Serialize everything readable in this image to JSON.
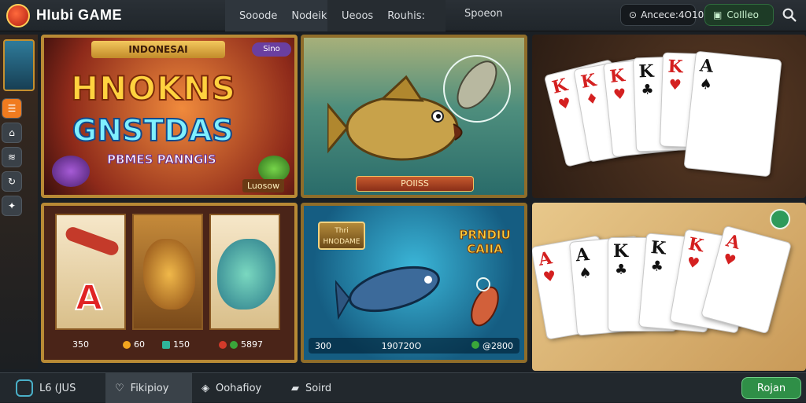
{
  "header": {
    "brand": "HIubi GAME",
    "nav_group1": [
      "Sooode",
      "Nodeik"
    ],
    "nav_group2": [
      "Ueoos",
      "Rouhis:"
    ],
    "nav_single": "Spoeon",
    "balance": "Ancece:4O10",
    "cash_button": "CoIlleo"
  },
  "tiles": {
    "slot1": {
      "banner": "INDONESAI",
      "badge": "Sino",
      "title_line1": "HNOKNS",
      "title_line2": "GNSTDAS",
      "subtitle": "PBMES PANNGIS",
      "tag": "Luosow"
    },
    "fish1": {
      "label": "POIISS"
    },
    "slot2": {
      "letter": "A",
      "stats": [
        "350",
        "60",
        "150",
        "5897"
      ]
    },
    "fish2": {
      "badge": "Thri HNODAME",
      "title": "PRNDIU CAIIA",
      "stats": [
        "300",
        "190720O",
        "@2800"
      ]
    },
    "cards1": {
      "cards": [
        {
          "rank": "K",
          "suit": "♥",
          "color": "red"
        },
        {
          "rank": "K",
          "suit": "♦",
          "color": "red"
        },
        {
          "rank": "K",
          "suit": "♥",
          "color": "red"
        },
        {
          "rank": "K",
          "suit": "♣",
          "color": "blk"
        },
        {
          "rank": "K",
          "suit": "♥",
          "color": "red"
        },
        {
          "rank": "A",
          "suit": "♠",
          "color": "blk"
        }
      ]
    },
    "cards2": {
      "cards": [
        {
          "rank": "A",
          "suit": "♥",
          "color": "red"
        },
        {
          "rank": "A",
          "suit": "♠",
          "color": "blk"
        },
        {
          "rank": "K",
          "suit": "♣",
          "color": "blk"
        },
        {
          "rank": "K",
          "suit": "♣",
          "color": "blk"
        },
        {
          "rank": "K",
          "suit": "♥",
          "color": "red"
        },
        {
          "rank": "A",
          "suit": "♥",
          "color": "red"
        }
      ]
    }
  },
  "bottom": {
    "home_label": "L6 (JUS",
    "pay_label": "Fikipioy",
    "collect_label": "Oohafioy",
    "sport_label": "Soird",
    "join_label": "Rojan"
  },
  "colors": {
    "accent": "#f07b1f",
    "brand_red": "#b21d12",
    "join_green": "#2f8f47"
  }
}
